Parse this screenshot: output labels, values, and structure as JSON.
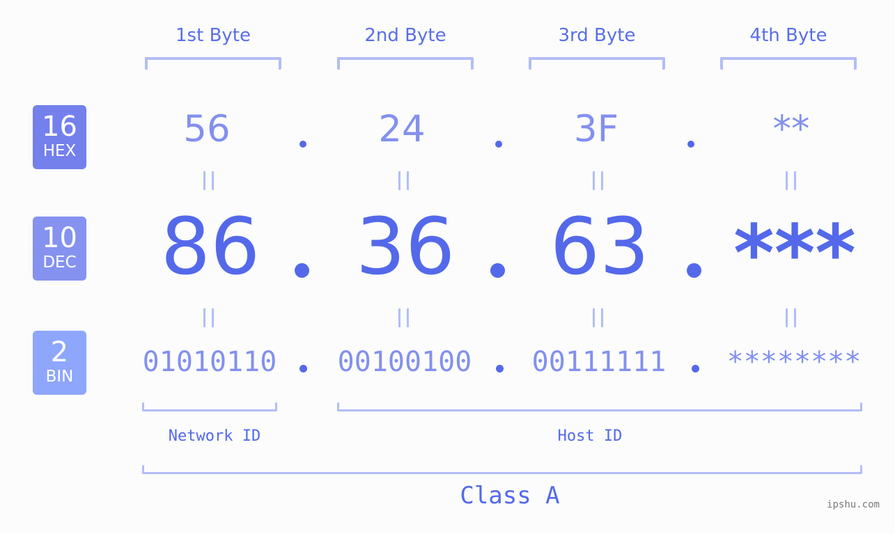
{
  "byte_headers": [
    "1st Byte",
    "2nd Byte",
    "3rd Byte",
    "4th Byte"
  ],
  "rows": {
    "hex": {
      "base": "16",
      "label": "HEX",
      "values": [
        "56",
        "24",
        "3F",
        "**"
      ]
    },
    "dec": {
      "base": "10",
      "label": "DEC",
      "values": [
        "86",
        "36",
        "63",
        "***"
      ]
    },
    "bin": {
      "base": "2",
      "label": "BIN",
      "values": [
        "01010110",
        "00100100",
        "00111111",
        "********"
      ]
    }
  },
  "segments": {
    "network_id": "Network ID",
    "host_id": "Host ID"
  },
  "ip_class": "Class A",
  "watermark": "ipshu.com",
  "colors": {
    "accent": "#5469ea",
    "light_value": "#8390ee",
    "bracket": "#b3bdf7",
    "hex_badge": "#7480ec",
    "dec_badge": "#8592f0",
    "bin_badge": "#8ea6fb",
    "background": "#fbfcfb"
  }
}
